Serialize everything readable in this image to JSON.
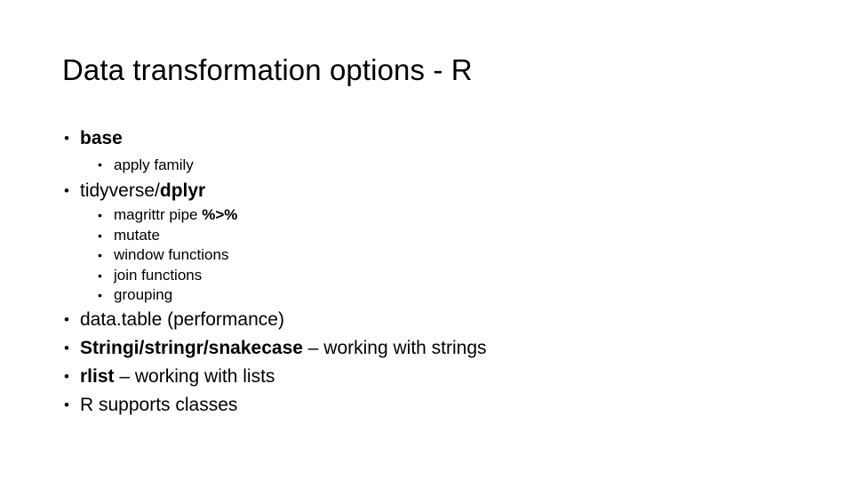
{
  "slide": {
    "title": "Data transformation options - R",
    "background_color": "#ffffff",
    "text_color": "#000000",
    "bullet_glyph": "•",
    "content": [
      {
        "level": 1,
        "name": "bullet-base",
        "runs": [
          {
            "text": "base",
            "bold": true
          }
        ]
      },
      {
        "level": 2,
        "name": "bullet-apply-family",
        "runs": [
          {
            "text": "apply family",
            "bold": false
          }
        ]
      },
      {
        "level": 1,
        "name": "bullet-tidyverse-dplyr",
        "runs": [
          {
            "text": "tidyverse/",
            "bold": false
          },
          {
            "text": "dplyr",
            "bold": true
          }
        ]
      },
      {
        "level": 3,
        "name": "bullet-magrittr-pipe",
        "runs": [
          {
            "text": "magrittr pipe ",
            "bold": false
          },
          {
            "text": "%>%",
            "bold": true
          }
        ]
      },
      {
        "level": 3,
        "name": "bullet-mutate",
        "runs": [
          {
            "text": "mutate",
            "bold": false
          }
        ]
      },
      {
        "level": 3,
        "name": "bullet-window-functions",
        "runs": [
          {
            "text": "window functions",
            "bold": false
          }
        ]
      },
      {
        "level": 3,
        "name": "bullet-join-functions",
        "runs": [
          {
            "text": "join functions",
            "bold": false
          }
        ]
      },
      {
        "level": 3,
        "name": "bullet-grouping",
        "runs": [
          {
            "text": "grouping",
            "bold": false
          }
        ]
      },
      {
        "level": 1,
        "name": "bullet-data-table",
        "runs": [
          {
            "text": "data.table (performance)",
            "bold": false
          }
        ]
      },
      {
        "level": 1,
        "name": "bullet-string-packages",
        "runs": [
          {
            "text": "Stringi/stringr/snakecase",
            "bold": true
          },
          {
            "text": " – working with strings",
            "bold": false
          }
        ]
      },
      {
        "level": 1,
        "name": "bullet-rlist",
        "runs": [
          {
            "text": "rlist",
            "bold": true
          },
          {
            "text": " – working with lists",
            "bold": false
          }
        ]
      },
      {
        "level": 1,
        "name": "bullet-r-supports-classes",
        "runs": [
          {
            "text": "R supports classes",
            "bold": false
          }
        ]
      }
    ]
  }
}
